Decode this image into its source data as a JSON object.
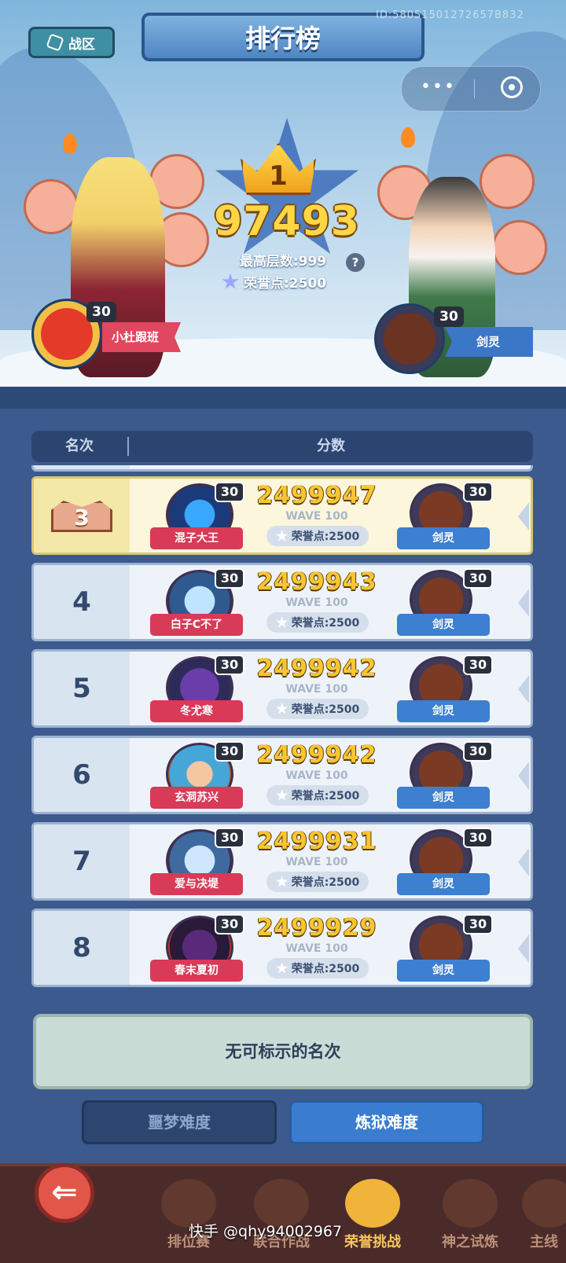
{
  "header": {
    "zone_label": "战区",
    "title": "排行榜",
    "player_id": "ID:58051501272657B832",
    "menu_dots": "•••"
  },
  "top_player": {
    "rank": "1",
    "score": "97493",
    "max_floor": "最高层数:999",
    "honor": "荣誉点:2500",
    "help": "?",
    "player": {
      "name": "小杜跟班",
      "level": "30"
    },
    "partner": {
      "name": "剑灵",
      "level": "30"
    }
  },
  "columns": {
    "rank": "名次",
    "score": "分数"
  },
  "rows": [
    {
      "rank": "3",
      "level": "30",
      "name": "混子大王",
      "score": "2499947",
      "wave": "WAVE 100",
      "honor": "荣誉点:2500",
      "partner": "剑灵",
      "partner_level": "30"
    },
    {
      "rank": "4",
      "level": "30",
      "name": "白子C不了",
      "score": "2499943",
      "wave": "WAVE 100",
      "honor": "荣誉点:2500",
      "partner": "剑灵",
      "partner_level": "30"
    },
    {
      "rank": "5",
      "level": "30",
      "name": "冬尤寒",
      "score": "2499942",
      "wave": "WAVE 100",
      "honor": "荣誉点:2500",
      "partner": "剑灵",
      "partner_level": "30"
    },
    {
      "rank": "6",
      "level": "30",
      "name": "玄洞苏兴",
      "score": "2499942",
      "wave": "WAVE 100",
      "honor": "荣誉点:2500",
      "partner": "剑灵",
      "partner_level": "30"
    },
    {
      "rank": "7",
      "level": "30",
      "name": "爱与决堤",
      "score": "2499931",
      "wave": "WAVE 100",
      "honor": "荣誉点:2500",
      "partner": "剑灵",
      "partner_level": "30"
    },
    {
      "rank": "8",
      "level": "30",
      "name": "春末夏初",
      "score": "2499929",
      "wave": "WAVE 100",
      "honor": "荣誉点:2500",
      "partner": "剑灵",
      "partner_level": "30"
    }
  ],
  "my_rank": "无可标示的名次",
  "difficulty": {
    "nightmare": "噩梦难度",
    "purgatory": "炼狱难度"
  },
  "nav": {
    "back": "⇐",
    "items": [
      "排位赛",
      "联合作战",
      "荣誉挑战",
      "神之试炼",
      "主线"
    ]
  },
  "watermark": "快手 @qhy94002967",
  "colors": {
    "accent_blue": "#3a7ccf",
    "name_red": "#d83a57",
    "score_gold": "#f9c531",
    "top3_bg": "#fbf6dc"
  }
}
